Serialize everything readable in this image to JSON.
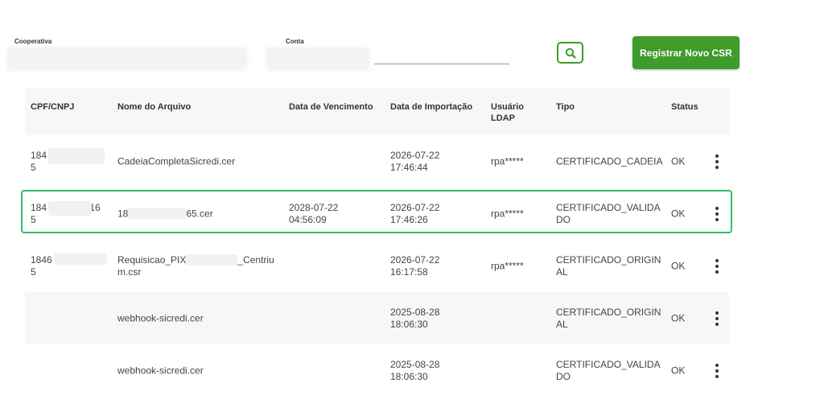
{
  "filters": {
    "cooperativa_label": "Cooperativa",
    "conta_label": "Conta"
  },
  "actions": {
    "register_label": "Registrar Novo CSR"
  },
  "table": {
    "headers": {
      "cpf": "CPF/CNPJ",
      "arquivo": "Nome do Arquivo",
      "vencimento": "Data de Vencimento",
      "importacao": "Data de Importação",
      "usuario_line1": "Usuário",
      "usuario_line2": "LDAP",
      "tipo": "Tipo",
      "status": "Status"
    },
    "rows": [
      {
        "cpf_l1": "184",
        "cpf_l2": "5",
        "arquivo_l1": "CadeiaCompletaSicredi.cer",
        "arquivo_l2": "",
        "venc_l1": "",
        "venc_l2": "",
        "imp_l1": "2026-07-22",
        "imp_l2": "17:46:44",
        "usuario": "rpa*****",
        "tipo_l1": "CERTIFICADO_CADEIA",
        "tipo_l2": "",
        "status": "OK"
      },
      {
        "cpf_l1": "184                16",
        "cpf_l2": "5",
        "arquivo_l1": "18",
        "arquivo_l1b": "65.cer",
        "arquivo_l2": "",
        "venc_l1": "2028-07-22",
        "venc_l2": "04:56:09",
        "imp_l1": "2026-07-22",
        "imp_l2": "17:46:26",
        "usuario": "rpa*****",
        "tipo_l1": "CERTIFICADO_VALIDA",
        "tipo_l2": "DO",
        "status": "OK"
      },
      {
        "cpf_l1": "1846",
        "cpf_l2": "5",
        "arquivo_l1": "Requisicao_PIX",
        "arquivo_l1b": "_Centriu",
        "arquivo_l2": "m.csr",
        "venc_l1": "",
        "venc_l2": "",
        "imp_l1": "2026-07-22",
        "imp_l2": "16:17:58",
        "usuario": "rpa*****",
        "tipo_l1": "CERTIFICADO_ORIGIN",
        "tipo_l2": "AL",
        "status": "OK"
      },
      {
        "cpf_l1": "",
        "cpf_l2": "",
        "arquivo_l1": "webhook-sicredi.cer",
        "arquivo_l2": "",
        "venc_l1": "",
        "venc_l2": "",
        "imp_l1": "2025-08-28",
        "imp_l2": "18:06:30",
        "usuario": "",
        "tipo_l1": "CERTIFICADO_ORIGIN",
        "tipo_l2": "AL",
        "status": "OK"
      },
      {
        "cpf_l1": "",
        "cpf_l2": "",
        "arquivo_l1": "webhook-sicredi.cer",
        "arquivo_l2": "",
        "venc_l1": "",
        "venc_l2": "",
        "imp_l1": "2025-08-28",
        "imp_l2": "18:06:30",
        "usuario": "",
        "tipo_l1": "CERTIFICADO_VALIDA",
        "tipo_l2": "DO",
        "status": "OK"
      }
    ]
  },
  "icons": {
    "search": "search-icon",
    "row_menu": "kebab-menu-icon"
  },
  "colors": {
    "primary_green": "#3f9b2a",
    "highlight": "#2fbf6a"
  }
}
